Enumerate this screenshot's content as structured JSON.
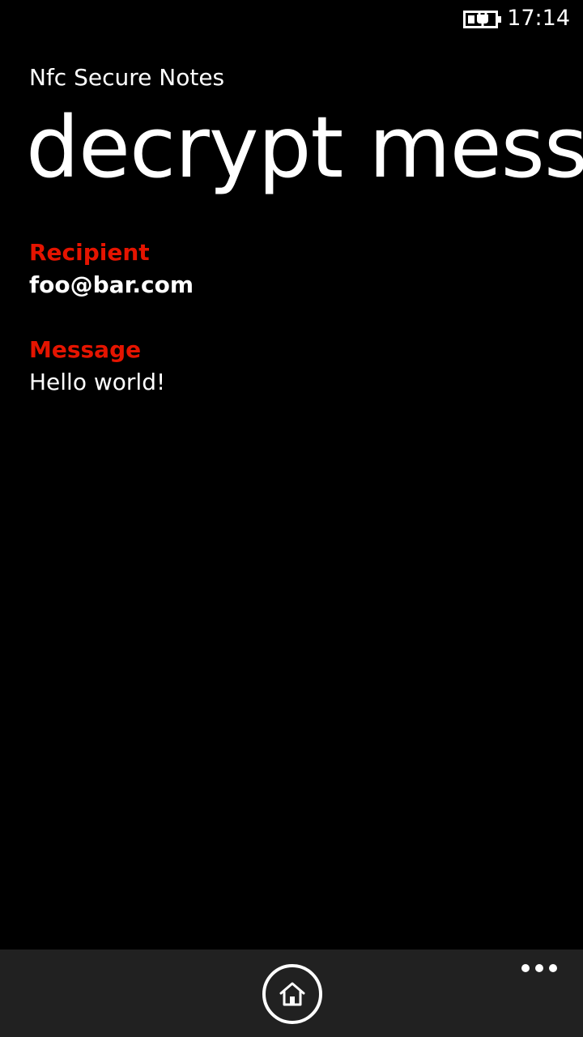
{
  "status_bar": {
    "battery_icon": "battery-charging-icon",
    "time": "17:14"
  },
  "app": {
    "title": "Nfc Secure Notes"
  },
  "page": {
    "title": "decrypt message"
  },
  "fields": {
    "recipient": {
      "label": "Recipient",
      "value": "foo@bar.com"
    },
    "message": {
      "label": "Message",
      "value": "Hello world!"
    }
  },
  "app_bar": {
    "home_icon": "home-icon",
    "more_icon": "ellipsis-icon"
  },
  "colors": {
    "background": "#000000",
    "accent": "#e51400",
    "text": "#ffffff",
    "app_bar": "#212121"
  }
}
